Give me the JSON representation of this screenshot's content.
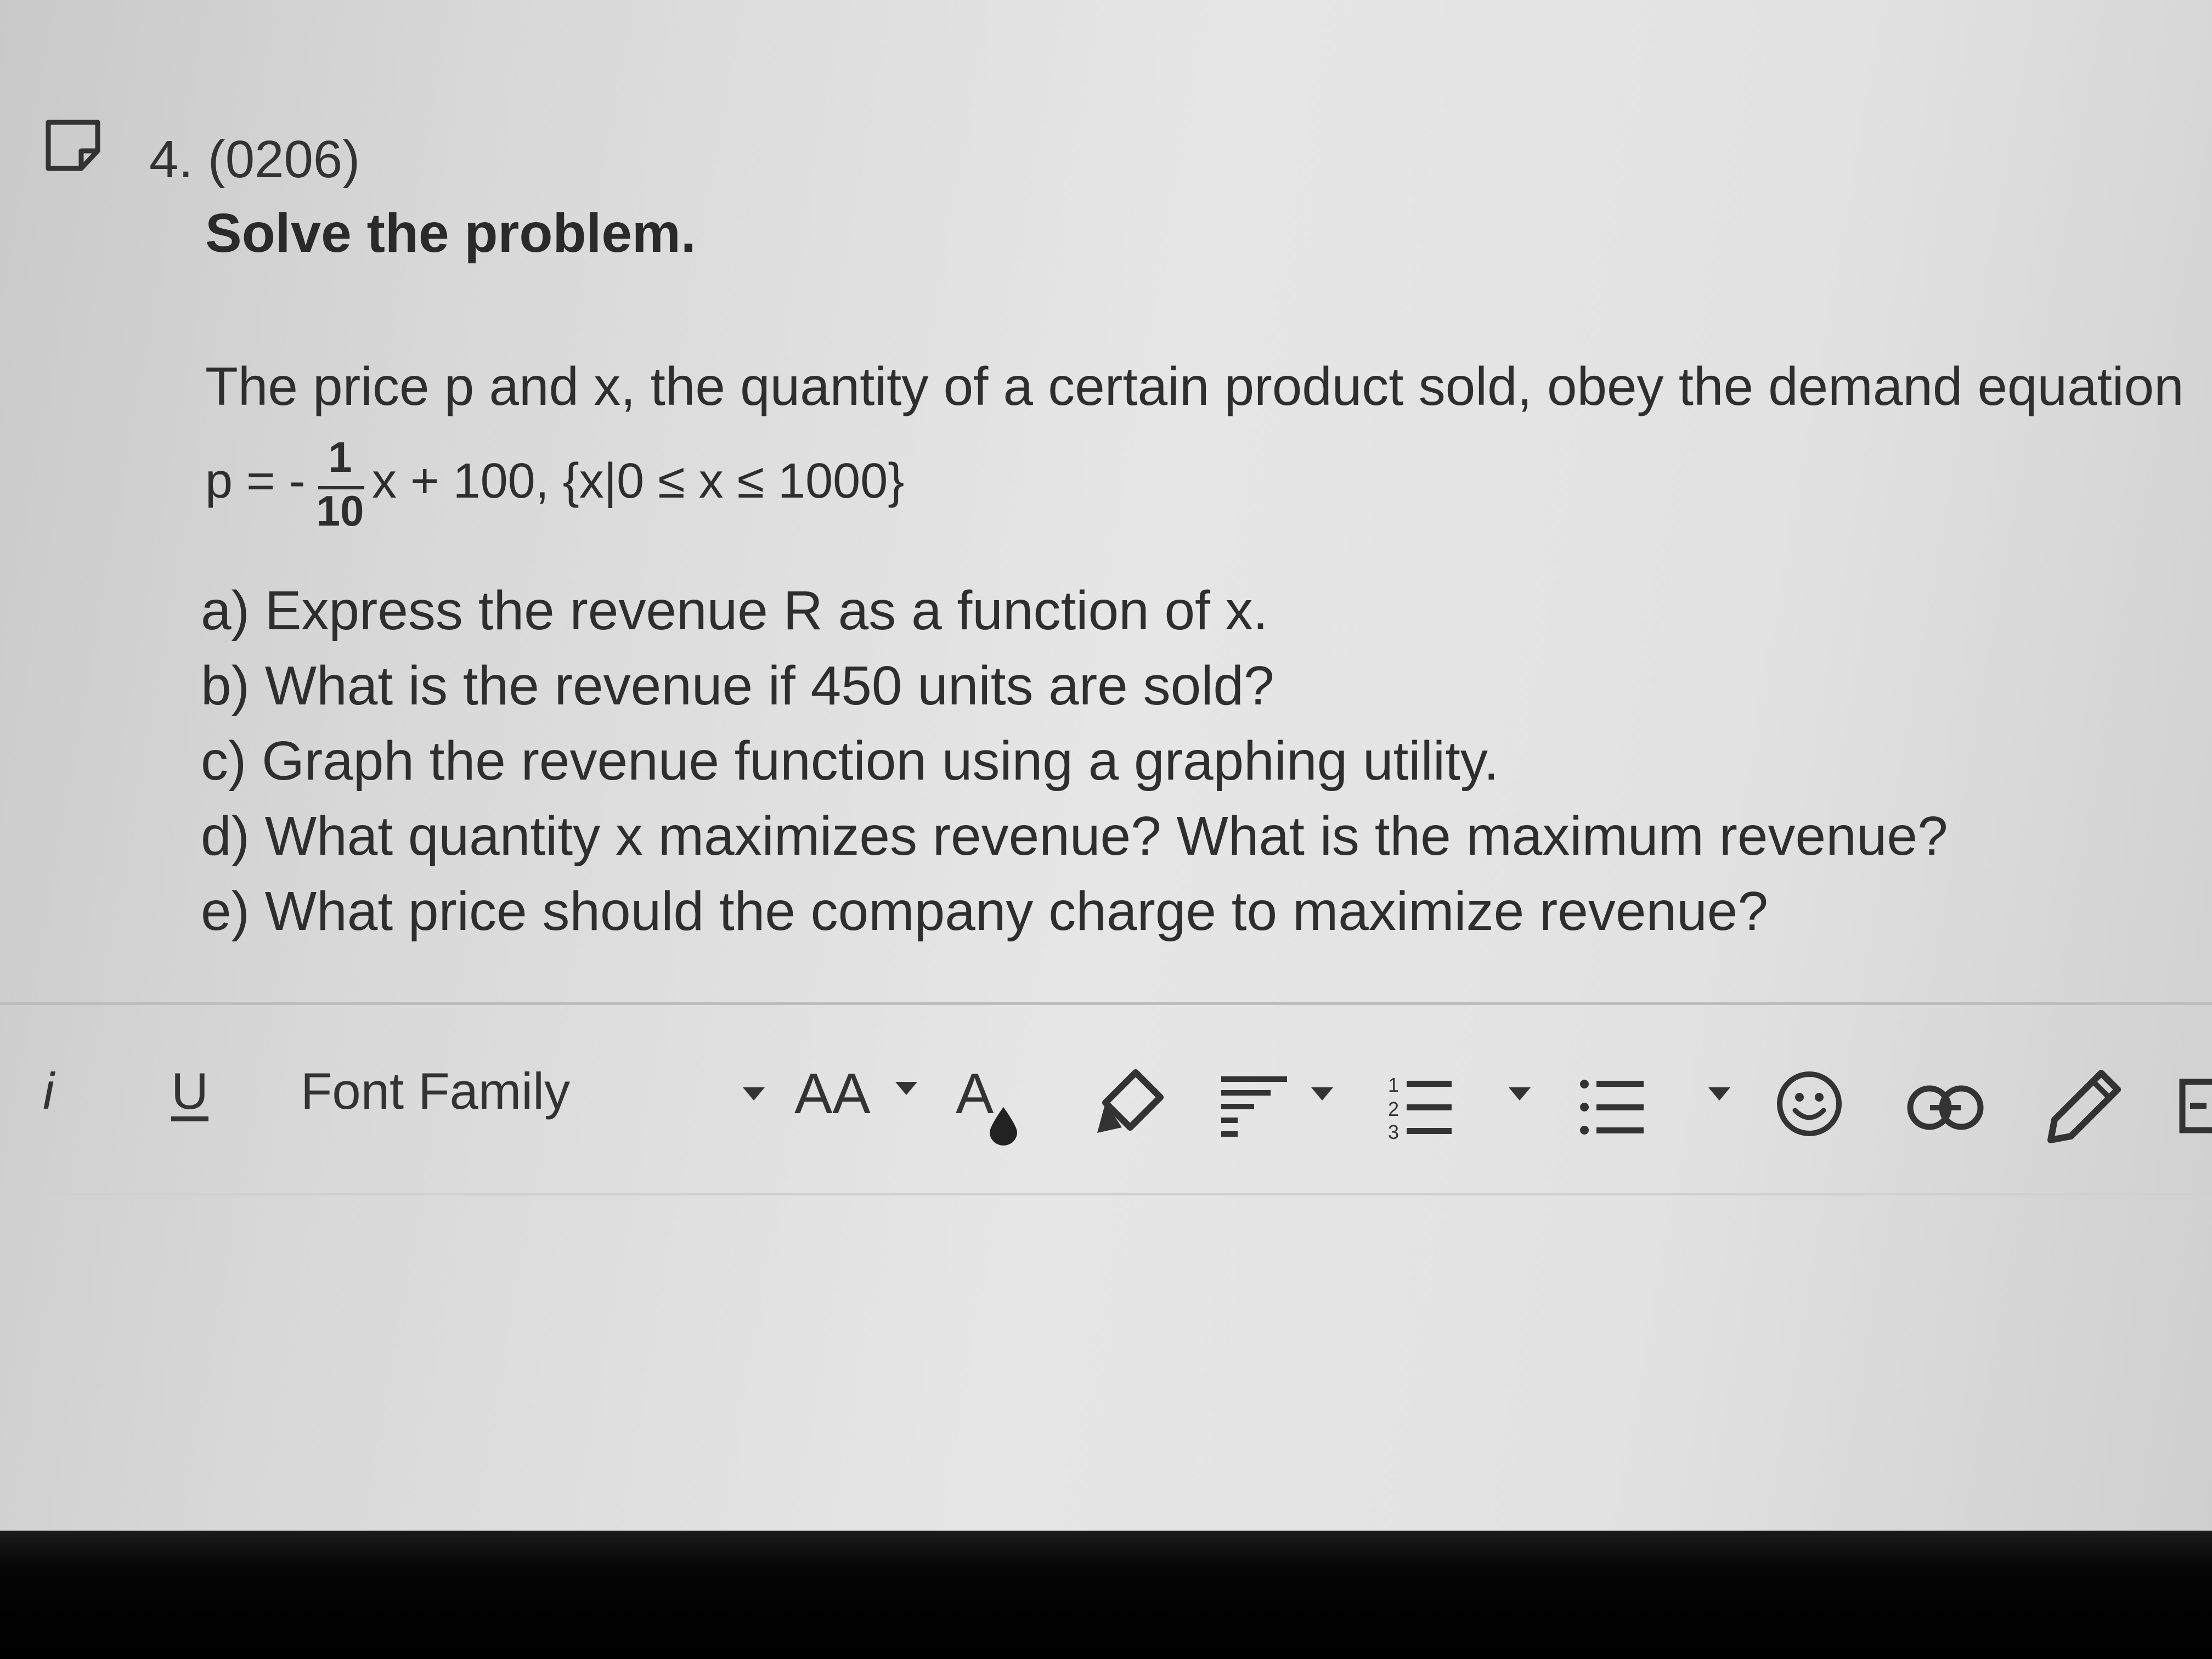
{
  "question": {
    "number_label": "4. (0206)",
    "instruction": "Solve the problem.",
    "statement": "The price p and x, the quantity of a certain product sold, obey the demand equation",
    "equation": {
      "lhs": "p = -",
      "fraction_numerator": "1",
      "fraction_denominator": "10",
      "rhs": "x + 100, {x|0 ≤ x ≤ 1000}"
    },
    "parts": [
      "a) Express the revenue R as a function of x.",
      "b) What is the revenue if 450 units are sold?",
      "c) Graph the revenue function using a graphing utility.",
      "d) What quantity x maximizes revenue? What is the maximum revenue?",
      "e) What price should the company charge to maximize revenue?"
    ]
  },
  "toolbar": {
    "italic_label": "i",
    "underline_label": "U",
    "font_family_label": "Font Family",
    "font_size_label": "AA",
    "text_color_label": "A"
  },
  "icons": {
    "flag": "flag-icon",
    "font_family_dropdown": "chevron-down-icon",
    "font_size_dropdown": "chevron-down-icon",
    "text_color": "text-color-icon",
    "highlight": "highlighter-icon",
    "align": "align-left-icon",
    "numbered_list": "numbered-list-icon",
    "bullet_list": "bullet-list-icon",
    "emoji": "smiley-icon",
    "link": "link-icon",
    "draw": "pencil-icon",
    "more": "image-icon"
  },
  "colors": {
    "text": "#2e2e2e",
    "background": "#e2e2e2",
    "bezel": "#000000"
  }
}
